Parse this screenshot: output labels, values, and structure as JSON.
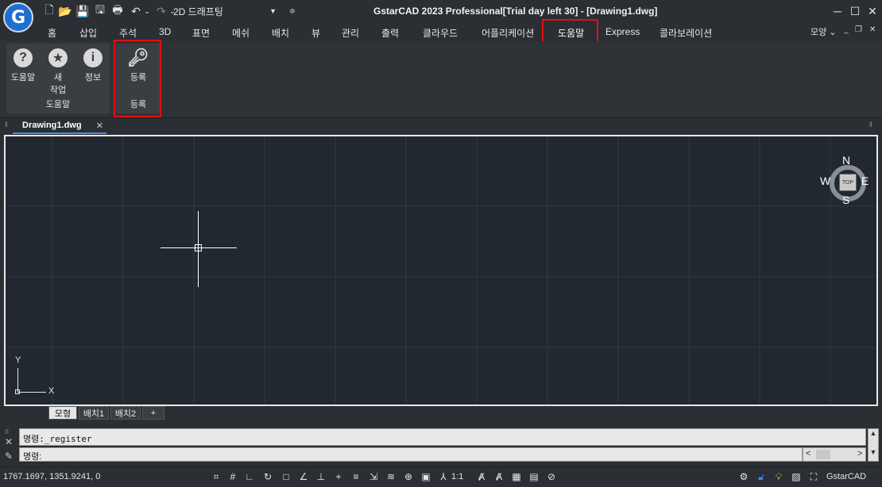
{
  "window": {
    "title": "GstarCAD 2023 Professional[Trial day left 30] - [Drawing1.dwg]",
    "workspace": "2D 드래프팅"
  },
  "tabs": [
    "홈",
    "삽입",
    "주석",
    "3D",
    "표면",
    "메쉬",
    "배치",
    "뷰",
    "관리",
    "출력",
    "클라우드",
    "어플리케이션",
    "도움말",
    "Express",
    "콜라보레이션"
  ],
  "active_tab": "도움말",
  "style_menu": "모양",
  "ribbon": {
    "help_group": {
      "label": "도움말",
      "buttons": [
        {
          "label": "도움말",
          "icon": "question-icon"
        },
        {
          "label": "새\n작업",
          "icon": "star-icon"
        },
        {
          "label": "정보",
          "icon": "info-icon"
        }
      ]
    },
    "register_group": {
      "label": "등록",
      "button": {
        "label": "등록",
        "icon": "key-icon"
      }
    }
  },
  "document_tab": "Drawing1.dwg",
  "viewcube": {
    "n": "N",
    "s": "S",
    "e": "E",
    "w": "W",
    "top": "TOP"
  },
  "ucs": {
    "x": "X",
    "y": "Y"
  },
  "layout_tabs": [
    "모형",
    "배치1",
    "배치2",
    "+"
  ],
  "active_layout": "모형",
  "command": {
    "history": "명령:_register",
    "prompt": "명령:"
  },
  "status": {
    "coordinates": "1767.1697, 1351.9241, 0",
    "scale": "1:1",
    "app": "GstarCAD"
  }
}
